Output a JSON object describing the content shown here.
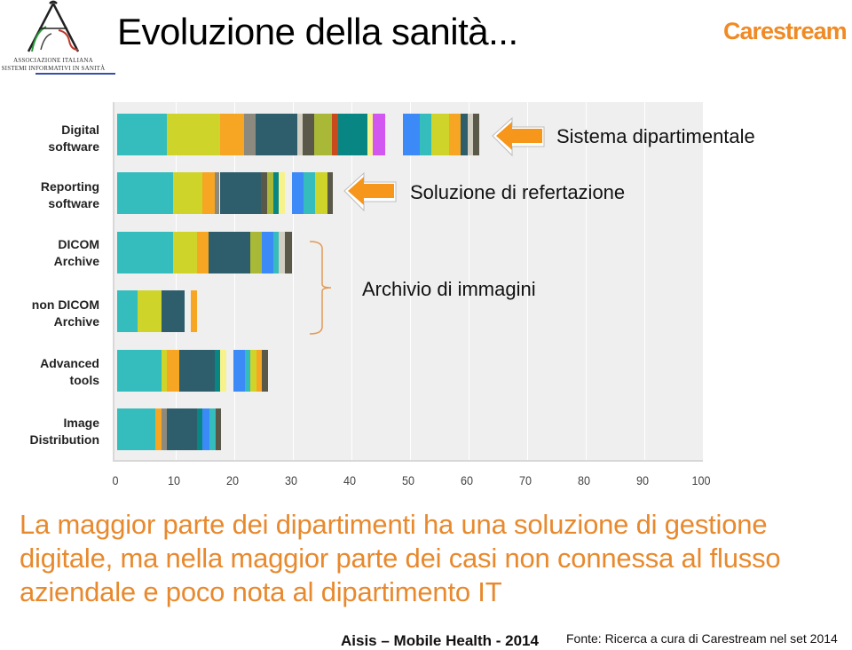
{
  "header": {
    "title": "Evoluzione della sanità...",
    "aisis_logo_line1": "ASSOCIAZIONE ITALIANA",
    "aisis_logo_line2": "SISTEMI INFORMATIVI IN SANITÀ",
    "brand_logo": "Carestream"
  },
  "annotations": {
    "row1": "Sistema dipartimentale",
    "row2": "Soluzione di refertazione",
    "rows3_4": "Archivio di immagini"
  },
  "body_text": "La maggior parte dei dipartimenti ha una soluzione di gestione digitale, ma nella maggior parte dei casi non connessa al flusso aziendale e poco nota al dipartimento IT",
  "footer": {
    "left": "Aisis – Mobile Health - 2014",
    "right": "Fonte: Ricerca a cura di Carestream nel set 2014"
  },
  "colors": {
    "teal": "#35bcbd",
    "yellow": "#cfd42a",
    "orange": "#f6a623",
    "gray": "#8c8a7e",
    "darkslate": "#2e5e6b",
    "beige": "#d2cfc2",
    "darkgray": "#5a5848",
    "olive": "#a9b837",
    "rust": "#c94a1c",
    "tealdark": "#088684",
    "lightyellow": "#f7f28a",
    "magenta": "#d257f0",
    "blue": "#3c8af8",
    "gap": "transparent",
    "accent_orange": "#e8892d"
  },
  "chart_data": {
    "type": "bar",
    "orientation": "horizontal-stacked",
    "title": "",
    "xlabel": "",
    "ylabel": "",
    "xlim": [
      0,
      100
    ],
    "x_ticks": [
      "0",
      "10",
      "20",
      "30",
      "40",
      "50",
      "60",
      "70",
      "80",
      "90",
      "100"
    ],
    "grid": true,
    "legend": "none",
    "categories": [
      "Digital software",
      "Reporting software",
      "DICOM Archive",
      "non DICOM Archive",
      "Advanced tools",
      "Image Distribution"
    ],
    "category_labels": [
      [
        "Digital",
        "software"
      ],
      [
        "Reporting",
        "software"
      ],
      [
        "DICOM",
        "Archive"
      ],
      [
        "non DICOM",
        "Archive"
      ],
      [
        "Advanced",
        "tools"
      ],
      [
        "Image",
        "Distribution"
      ]
    ],
    "rows": [
      {
        "segments": [
          {
            "color": "teal",
            "value": 8.5
          },
          {
            "color": "yellow",
            "value": 9.1
          },
          {
            "color": "orange",
            "value": 4.1
          },
          {
            "color": "gray",
            "value": 2.0
          },
          {
            "color": "darkslate",
            "value": 7.0
          },
          {
            "color": "beige",
            "value": 0.9
          },
          {
            "color": "darkgray",
            "value": 2.1
          },
          {
            "color": "olive",
            "value": 3.0
          },
          {
            "color": "rust",
            "value": 1.1
          },
          {
            "color": "tealdark",
            "value": 5.0
          },
          {
            "color": "lightyellow",
            "value": 0.9
          },
          {
            "color": "magenta",
            "value": 2.1
          },
          {
            "color": "gap",
            "value": 3.0
          },
          {
            "color": "blue",
            "value": 2.9
          },
          {
            "color": "teal",
            "value": 2.0
          },
          {
            "color": "yellow",
            "value": 3.0
          },
          {
            "color": "orange",
            "value": 2.0
          },
          {
            "color": "darkslate",
            "value": 1.1
          },
          {
            "color": "beige",
            "value": 0.9
          },
          {
            "color": "darkgray",
            "value": 1.1
          }
        ]
      },
      {
        "segments": [
          {
            "color": "teal",
            "value": 9.5
          },
          {
            "color": "yellow",
            "value": 5.0
          },
          {
            "color": "orange",
            "value": 2.1
          },
          {
            "color": "gray",
            "value": 0.9
          },
          {
            "color": "darkslate",
            "value": 7.0
          },
          {
            "color": "darkgray",
            "value": 1.1
          },
          {
            "color": "olive",
            "value": 1.1
          },
          {
            "color": "tealdark",
            "value": 0.9
          },
          {
            "color": "lightyellow",
            "value": 1.1
          },
          {
            "color": "gap",
            "value": 1.1
          },
          {
            "color": "blue",
            "value": 2.0
          },
          {
            "color": "teal",
            "value": 2.0
          },
          {
            "color": "yellow",
            "value": 2.1
          },
          {
            "color": "darkgray",
            "value": 0.9
          }
        ]
      },
      {
        "segments": [
          {
            "color": "teal",
            "value": 9.5
          },
          {
            "color": "yellow",
            "value": 4.1
          },
          {
            "color": "orange",
            "value": 2.0
          },
          {
            "color": "darkslate",
            "value": 7.1
          },
          {
            "color": "olive",
            "value": 2.0
          },
          {
            "color": "blue",
            "value": 2.0
          },
          {
            "color": "teal",
            "value": 0.9
          },
          {
            "color": "beige",
            "value": 1.1
          },
          {
            "color": "darkgray",
            "value": 1.1
          }
        ]
      },
      {
        "segments": [
          {
            "color": "teal",
            "value": 3.5
          },
          {
            "color": "yellow",
            "value": 4.1
          },
          {
            "color": "darkslate",
            "value": 3.9
          },
          {
            "color": "gap",
            "value": 1.1
          },
          {
            "color": "orange",
            "value": 1.1
          }
        ]
      },
      {
        "segments": [
          {
            "color": "teal",
            "value": 7.6
          },
          {
            "color": "yellow",
            "value": 0.9
          },
          {
            "color": "orange",
            "value": 2.1
          },
          {
            "color": "darkslate",
            "value": 6.1
          },
          {
            "color": "tealdark",
            "value": 0.9
          },
          {
            "color": "lightyellow",
            "value": 1.1
          },
          {
            "color": "gap",
            "value": 1.1
          },
          {
            "color": "blue",
            "value": 2.0
          },
          {
            "color": "teal",
            "value": 0.9
          },
          {
            "color": "yellow",
            "value": 1.1
          },
          {
            "color": "orange",
            "value": 0.9
          },
          {
            "color": "darkgray",
            "value": 1.1
          }
        ]
      },
      {
        "segments": [
          {
            "color": "teal",
            "value": 6.5
          },
          {
            "color": "orange",
            "value": 1.1
          },
          {
            "color": "gray",
            "value": 0.9
          },
          {
            "color": "darkslate",
            "value": 5.2
          },
          {
            "color": "tealdark",
            "value": 0.9
          },
          {
            "color": "blue",
            "value": 1.1
          },
          {
            "color": "teal",
            "value": 1.1
          },
          {
            "color": "darkgray",
            "value": 0.9
          }
        ]
      }
    ]
  }
}
